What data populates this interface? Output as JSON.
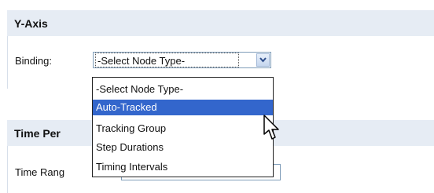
{
  "yaxis": {
    "title": "Y-Axis",
    "binding_label": "Binding:",
    "binding_value": "-Select Node Type-",
    "options": [
      {
        "label": "-Select Node Type-",
        "selected": false
      },
      {
        "label": "Auto-Tracked",
        "selected": true
      },
      {
        "label": "Tracking Group",
        "selected": false
      },
      {
        "label": "Step Durations",
        "selected": false
      },
      {
        "label": "Timing Intervals",
        "selected": false
      }
    ]
  },
  "time_period": {
    "title": "Time Per",
    "range_label": "Time Rang"
  },
  "colors": {
    "header_bg": "#e6ecf4",
    "selection": "#3366cc",
    "input_border": "#7f9db9"
  }
}
